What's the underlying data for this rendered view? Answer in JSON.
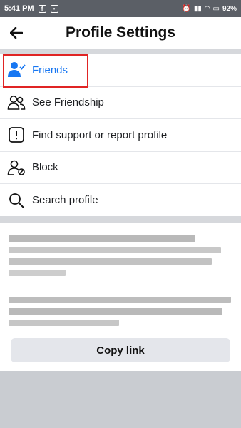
{
  "status_bar": {
    "time": "5:41 PM",
    "battery": "92%"
  },
  "header": {
    "title": "Profile Settings"
  },
  "menu": {
    "items": [
      {
        "label": "Friends",
        "icon": "friends-check-icon",
        "active": true
      },
      {
        "label": "See Friendship",
        "icon": "people-icon"
      },
      {
        "label": "Find support or report profile",
        "icon": "report-icon"
      },
      {
        "label": "Block",
        "icon": "block-user-icon"
      },
      {
        "label": "Search profile",
        "icon": "search-icon"
      }
    ]
  },
  "share": {
    "copy_label": "Copy link"
  },
  "colors": {
    "accent": "#1877f2",
    "highlight": "#e02424"
  }
}
